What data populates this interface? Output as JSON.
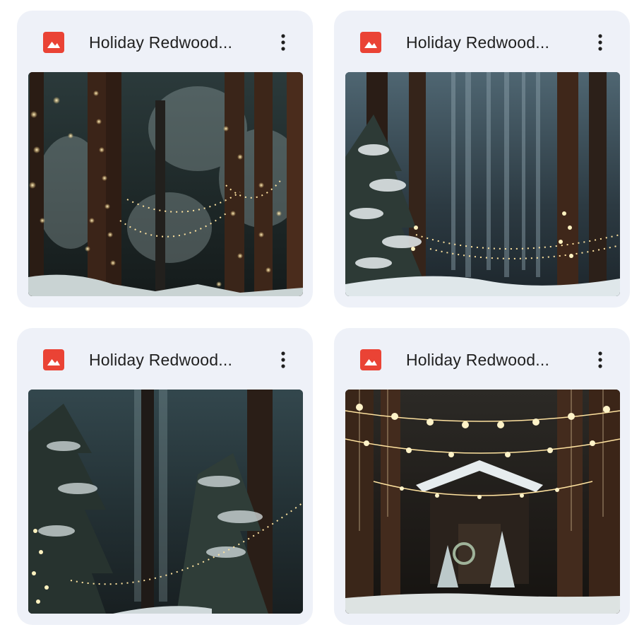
{
  "files": [
    {
      "name": "Holiday Redwood...",
      "type_icon": "image-file-icon",
      "menu_icon": "more-vert-icon",
      "thumbnail": "snowy redwood forest with string lights on trunks"
    },
    {
      "name": "Holiday Redwood...",
      "type_icon": "image-file-icon",
      "menu_icon": "more-vert-icon",
      "thumbnail": "snow covered redwood path with string lights"
    },
    {
      "name": "Holiday Redwood...",
      "type_icon": "image-file-icon",
      "menu_icon": "more-vert-icon",
      "thumbnail": "dark snowy forest with garland of lights"
    },
    {
      "name": "Holiday Redwood...",
      "type_icon": "image-file-icon",
      "menu_icon": "more-vert-icon",
      "thumbnail": "redwood chapel with hanging string lights"
    }
  ],
  "colors": {
    "card_background": "#eef1f8",
    "file_icon": "#ea4335",
    "title_text": "#1f1f1f"
  }
}
